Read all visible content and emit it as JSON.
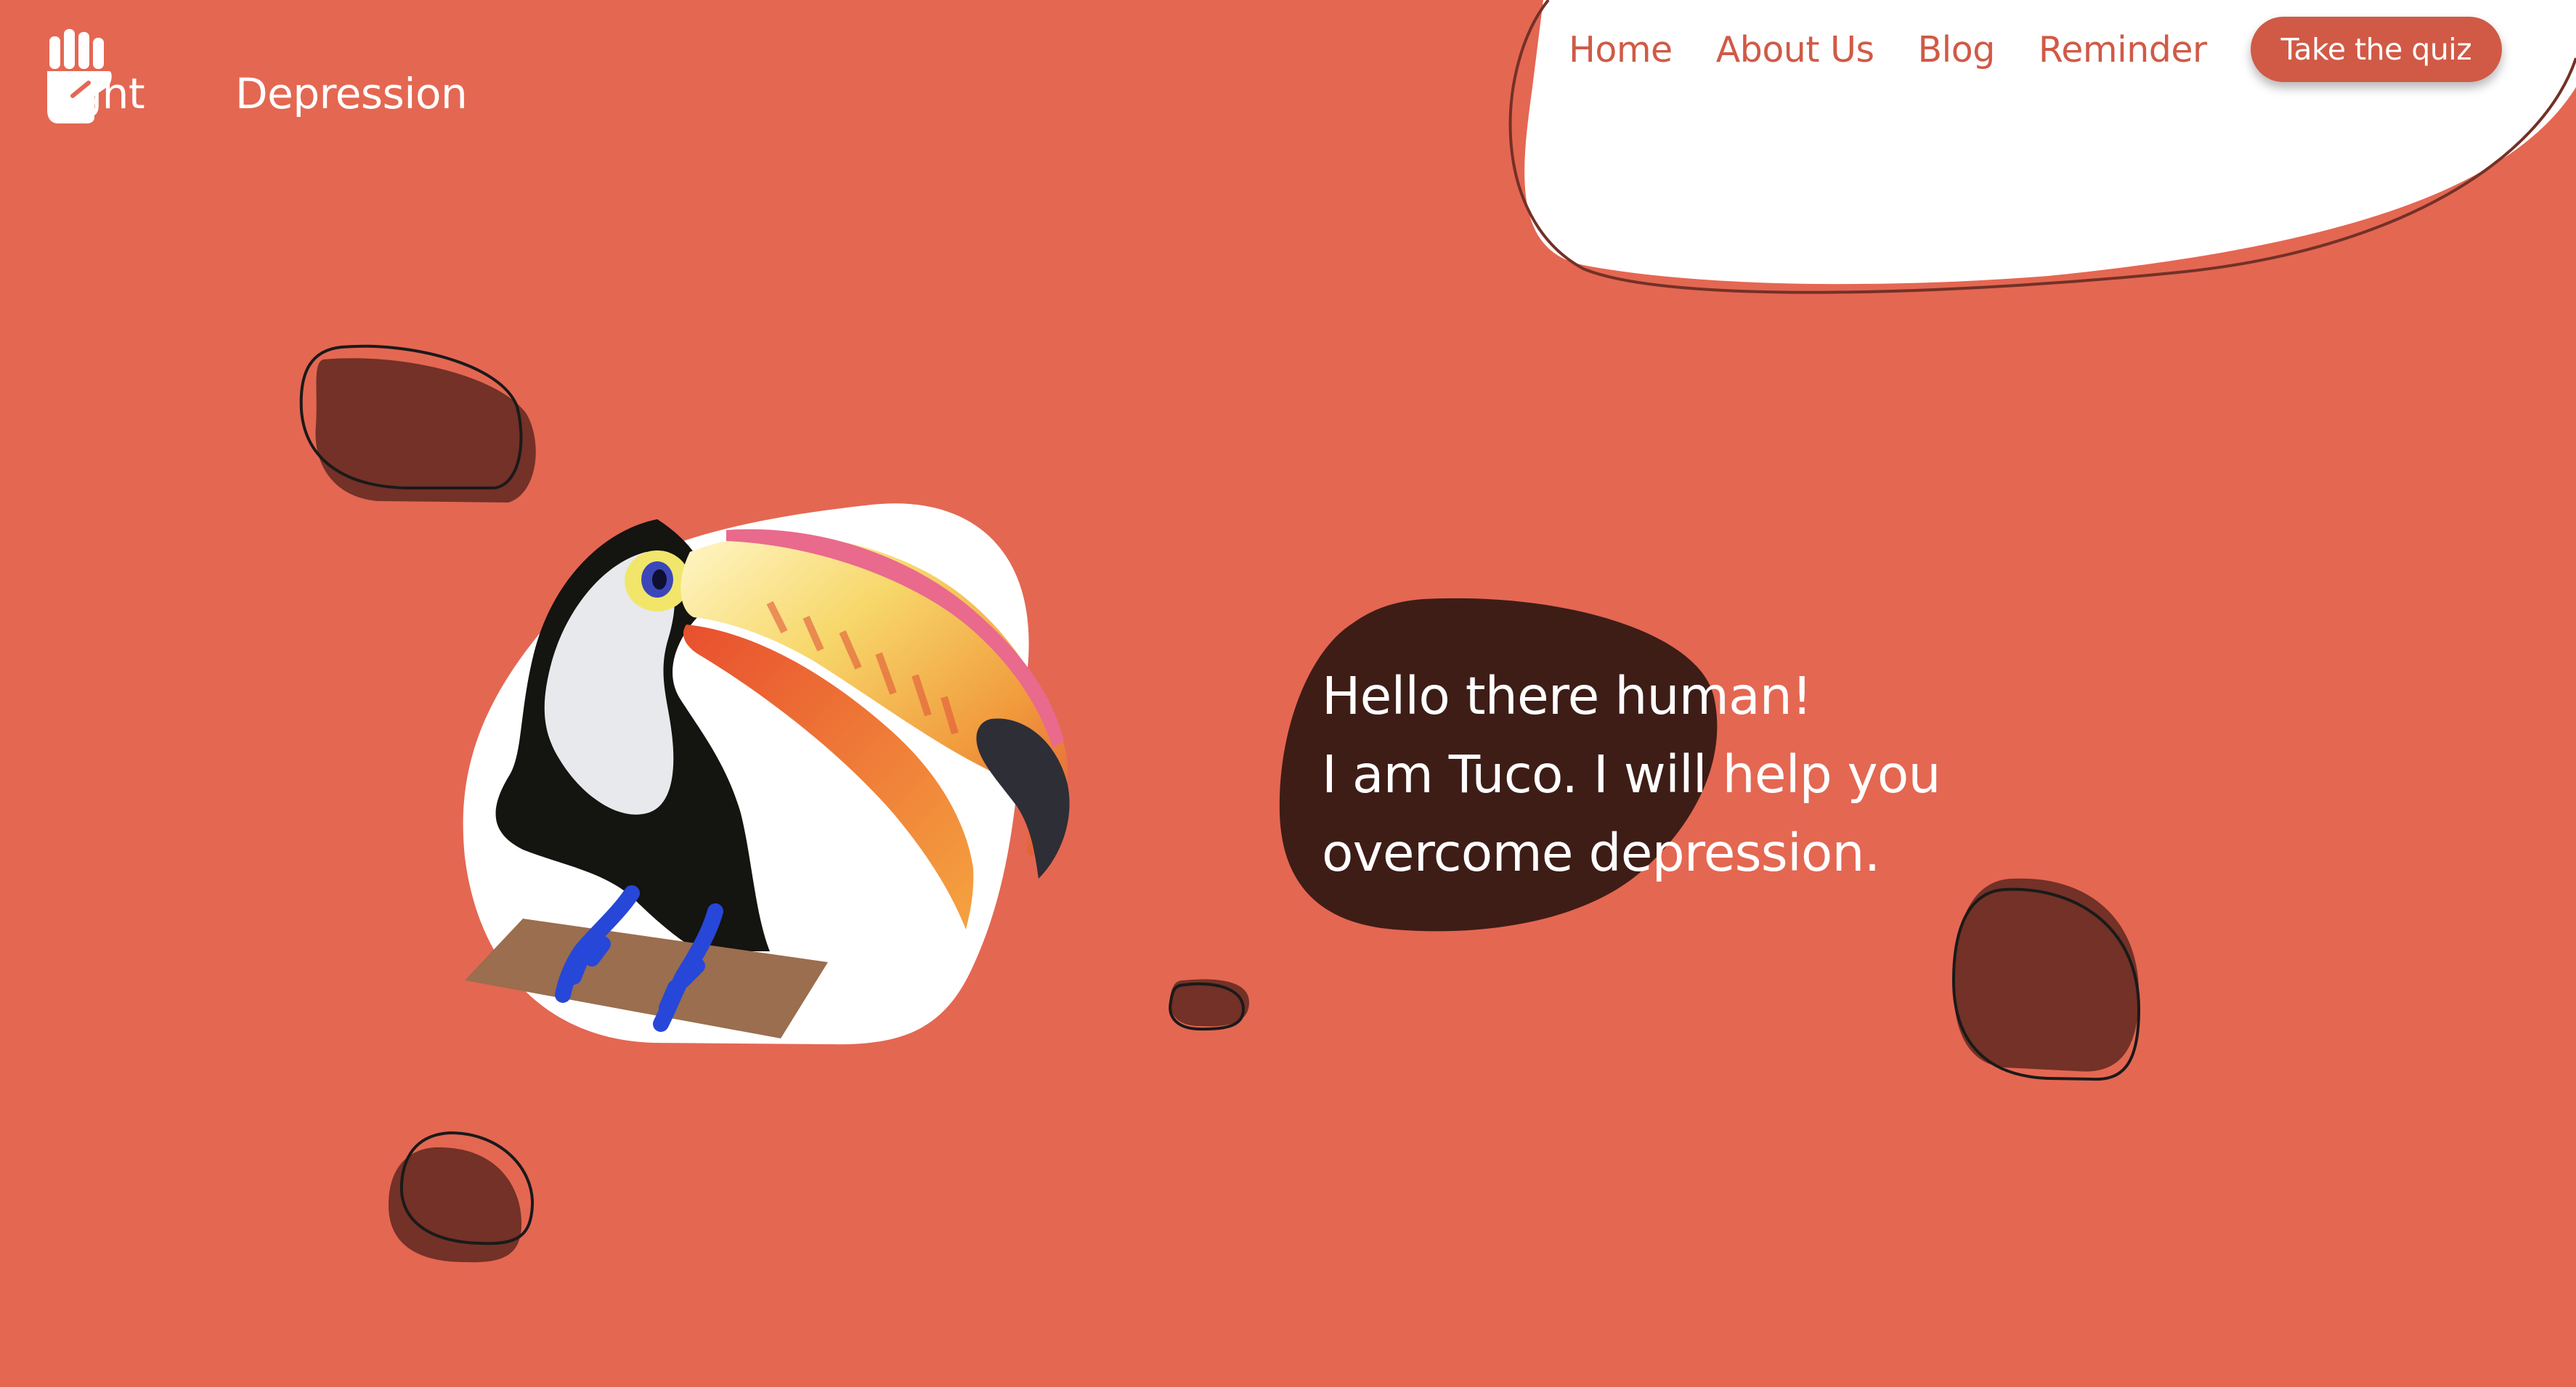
{
  "logo": {
    "word_left": "Fight",
    "word_right": "Depression",
    "icon": "raised-fist-icon"
  },
  "nav": {
    "items": [
      {
        "label": "Home"
      },
      {
        "label": "About Us"
      },
      {
        "label": "Blog"
      },
      {
        "label": "Reminder"
      }
    ],
    "cta_label": "Take the quiz"
  },
  "hero": {
    "mascot": "toucan-illustration",
    "greeting_lines": [
      "Hello there human!",
      "I am Tuco. I will help you",
      "overcome depression."
    ]
  },
  "colors": {
    "background": "#E46752",
    "accent": "#D05A46",
    "blob_dark": "#733127",
    "speech_bubble": "#3E1D17",
    "header_blob": "#FFFFFF"
  }
}
